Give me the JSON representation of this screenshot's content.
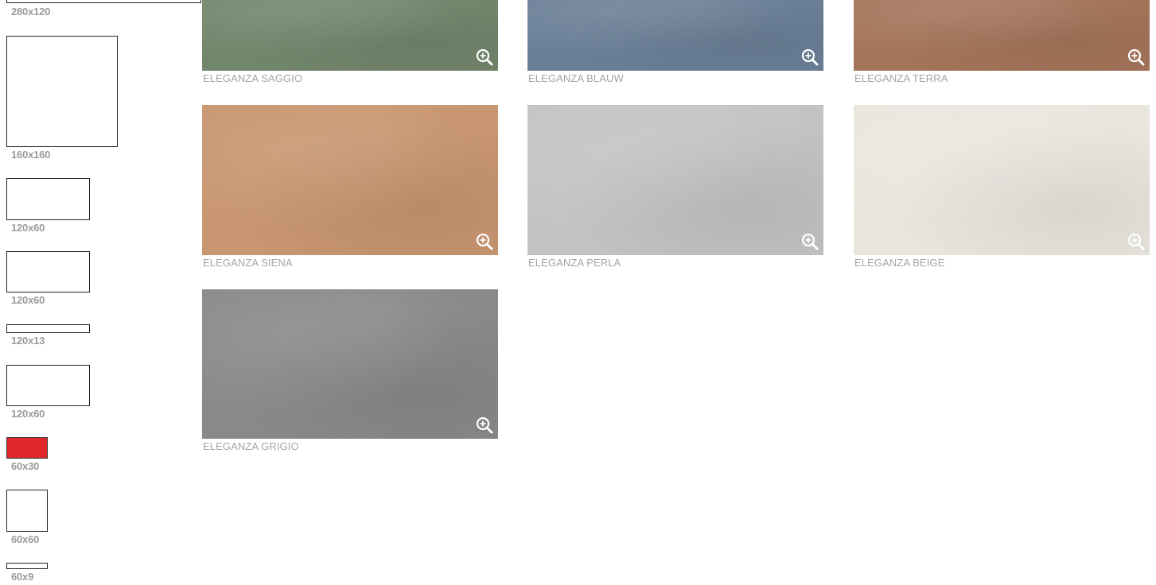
{
  "sizes": [
    {
      "label": "280x120",
      "selected": false
    },
    {
      "label": "160x160",
      "selected": false
    },
    {
      "label": "120x60",
      "selected": false
    },
    {
      "label": "120x60",
      "selected": false
    },
    {
      "label": "120x13",
      "selected": false
    },
    {
      "label": "120x60",
      "selected": false
    },
    {
      "label": "60x30",
      "selected": true
    },
    {
      "label": "60x60",
      "selected": false
    },
    {
      "label": "60x9",
      "selected": false
    }
  ],
  "colors": {
    "selected_size": "#e0262b",
    "label_grey": "#a5a5a5"
  },
  "zoom_icon": "zoom-in-magnifier",
  "tiles": [
    {
      "name": "ELEGANZA SAGGIO",
      "color": "#72866c"
    },
    {
      "name": "ELEGANZA BLAUW",
      "color": "#6a7f97"
    },
    {
      "name": "ELEGANZA TERRA",
      "color": "#a4745a"
    },
    {
      "name": "ELEGANZA SIENA",
      "color": "#c89670"
    },
    {
      "name": "ELEGANZA PERLA",
      "color": "#c3c3c6"
    },
    {
      "name": "ELEGANZA BEIGE",
      "color": "#e9e6de"
    },
    {
      "name": "ELEGANZA GRIGIO",
      "color": "#898989"
    }
  ]
}
